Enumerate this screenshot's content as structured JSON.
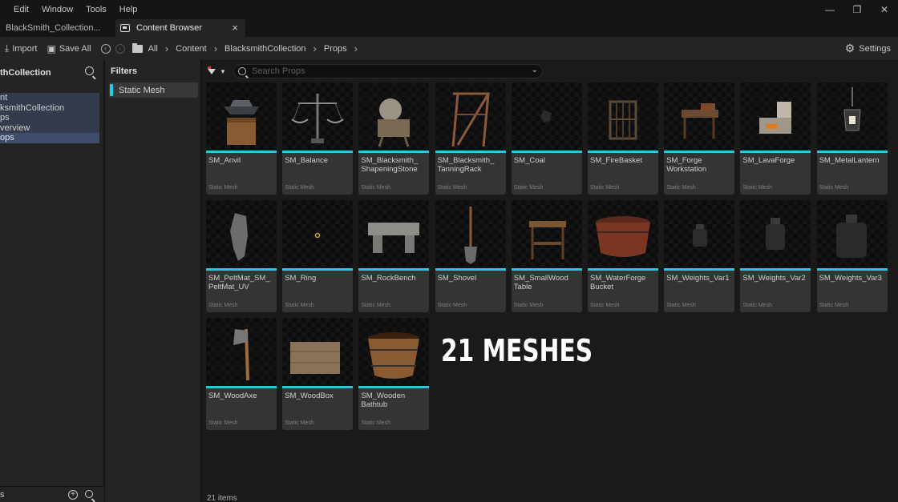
{
  "menubar": {
    "items": [
      "Edit",
      "Window",
      "Tools",
      "Help"
    ]
  },
  "window_controls": {
    "minimize": "—",
    "restore": "❐",
    "close": "✕"
  },
  "tabs": [
    {
      "label": "BlackSmith_Collection..."
    },
    {
      "label": "Content Browser",
      "close": "×"
    }
  ],
  "toolbar": {
    "import_label": "Import",
    "save_all_label": "Save All",
    "breadcrumbs": [
      "All",
      "Content",
      "BlacksmithCollection",
      "Props"
    ],
    "settings_label": "Settings"
  },
  "left_panel": {
    "title": "thCollection",
    "tree": [
      {
        "label": "nt"
      },
      {
        "label": "ksmithCollection"
      },
      {
        "label": "ps"
      },
      {
        "label": "verview"
      },
      {
        "label": "ops",
        "selected": true
      }
    ],
    "footer_label": "s"
  },
  "filters": {
    "title": "Filters",
    "chips": [
      "Static Mesh"
    ]
  },
  "search": {
    "placeholder": "Search Props"
  },
  "assets": [
    {
      "name": "SM_Anvil",
      "type": "Static Mesh"
    },
    {
      "name": "SM_Balance",
      "type": "Static Mesh"
    },
    {
      "name": "SM_Blacksmith_ ShapeningStone",
      "type": "Static Mesh"
    },
    {
      "name": "SM_Blacksmith_ TanningRack",
      "type": "Static Mesh"
    },
    {
      "name": "SM_Coal",
      "type": "Static Mesh"
    },
    {
      "name": "SM_FireBasket",
      "type": "Static Mesh"
    },
    {
      "name": "SM_Forge Workstation",
      "type": "Static Mesh"
    },
    {
      "name": "SM_LavaForge",
      "type": "Static Mesh"
    },
    {
      "name": "SM_MetalLantern",
      "type": "Static Mesh"
    },
    {
      "name": "SM_PeltMat_SM_ PeltMat_UV",
      "type": "Static Mesh"
    },
    {
      "name": "SM_Ring",
      "type": "Static Mesh"
    },
    {
      "name": "SM_RockBench",
      "type": "Static Mesh"
    },
    {
      "name": "SM_Shovel",
      "type": "Static Mesh"
    },
    {
      "name": "SM_SmallWood Table",
      "type": "Static Mesh"
    },
    {
      "name": "SM_WaterForge Bucket",
      "type": "Static Mesh"
    },
    {
      "name": "SM_Weights_Var1",
      "type": "Static Mesh"
    },
    {
      "name": "SM_Weights_Var2",
      "type": "Static Mesh"
    },
    {
      "name": "SM_Weights_Var3",
      "type": "Static Mesh"
    },
    {
      "name": "SM_WoodAxe",
      "type": "Static Mesh"
    },
    {
      "name": "SM_WoodBox",
      "type": "Static Mesh"
    },
    {
      "name": "SM_Wooden Bathtub",
      "type": "Static Mesh"
    }
  ],
  "overlay_text": "21 MESHES",
  "item_count": "21 items",
  "colors": {
    "accent": "#2ec6dc",
    "selection": "#3e4d6b",
    "filter_bar": "#1fcde8"
  }
}
